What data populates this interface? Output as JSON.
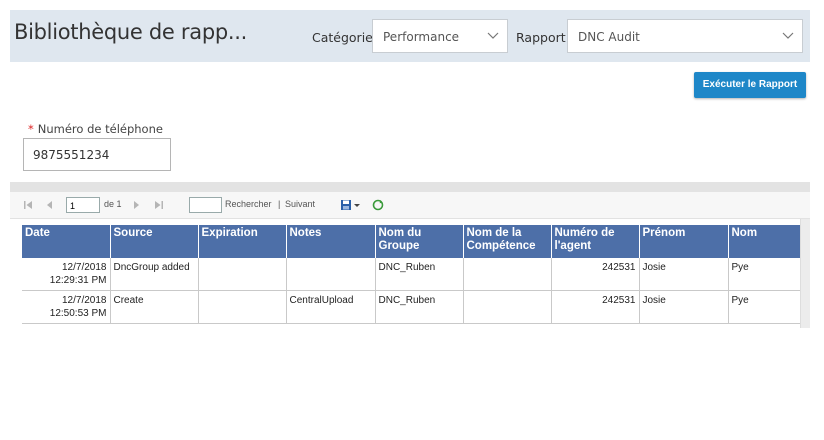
{
  "header": {
    "title": "Bibliothèque de rapp...",
    "category_label": "Catégorie",
    "category_value": "Performance",
    "report_label": "Rapport",
    "report_value": "DNC Audit"
  },
  "actions": {
    "run_label": "Exécuter le Rapport"
  },
  "form": {
    "required_marker": "*",
    "phone_label": "Numéro de téléphone",
    "phone_value": "9875551234"
  },
  "toolbar": {
    "page_value": "1",
    "of_label": "de 1",
    "find_label": "Rechercher",
    "separator": "|",
    "next_label": "Suivant"
  },
  "table": {
    "columns": [
      "Date",
      "Source",
      "Expiration",
      "Notes",
      "Nom du Groupe",
      "Nom de la Compétence",
      "Numéro de l'agent",
      "Prénom",
      "Nom"
    ],
    "rows": [
      {
        "date": "12/7/2018",
        "time": "12:29:31 PM",
        "source": "DncGroup added",
        "expiration": "",
        "notes": "",
        "group": "DNC_Ruben",
        "skill": "",
        "agent": "242531",
        "first": "Josie",
        "last": "Pye"
      },
      {
        "date": "12/7/2018",
        "time": "12:50:53 PM",
        "source": "Create",
        "expiration": "",
        "notes": "CentralUpload",
        "group": "DNC_Ruben",
        "skill": "",
        "agent": "242531",
        "first": "Josie",
        "last": "Pye"
      }
    ]
  },
  "colors": {
    "header_bg": "#dfe7ef",
    "button": "#1e87c8",
    "table_header": "#4d6fa8"
  },
  "icons": [
    "chevron-down-icon",
    "first-page-icon",
    "prev-page-icon",
    "next-page-icon",
    "last-page-icon",
    "save-export-icon",
    "refresh-icon"
  ]
}
